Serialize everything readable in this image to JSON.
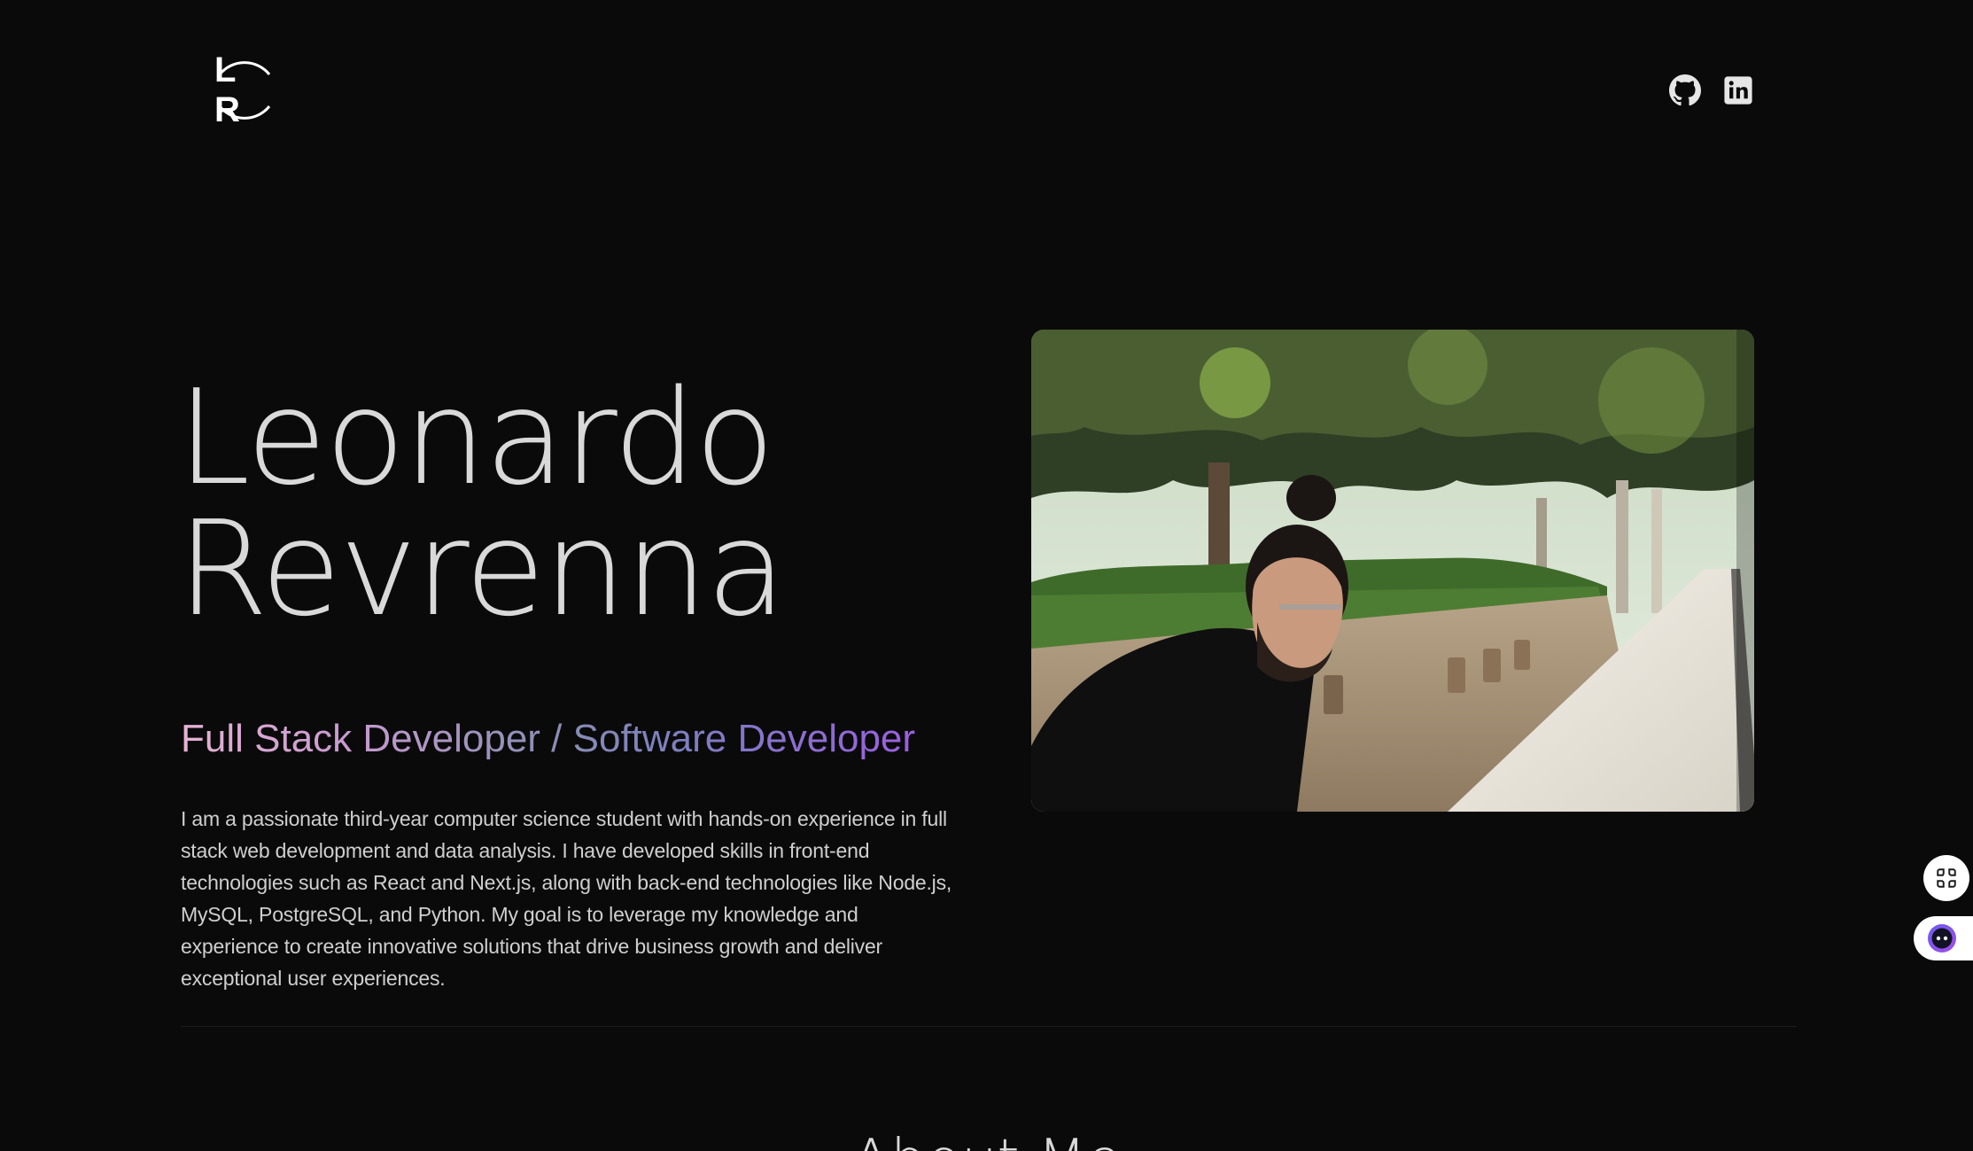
{
  "header": {
    "logo_text": "L R",
    "logo_icon": "lr-monogram-logo",
    "social": [
      {
        "name": "github",
        "icon": "github-icon"
      },
      {
        "name": "linkedin",
        "icon": "linkedin-icon"
      }
    ]
  },
  "hero": {
    "name_line1": "Leonardo",
    "name_line2": "Revrenna",
    "role": "Full Stack Developer / Software Developer",
    "description": "I am a passionate third-year computer science student with hands-on experience in full stack web development and data analysis. I have developed skills in front-end technologies such as React and Next.js, along with back-end technologies like Node.js, MySQL, PostgreSQL, and Python. My goal is to leverage my knowledge and experience to create innovative solutions that drive business growth and deliver exceptional user experiences.",
    "photo_icon": "profile-photo"
  },
  "about": {
    "heading": "About Me"
  },
  "widgets": {
    "apps_icon": "apps-grid-icon",
    "assistant_icon": "assistant-bot-icon"
  },
  "colors": {
    "background": "#0a0a0b",
    "text": "#d9d9d9",
    "gradient_start": "#e6b3d3",
    "gradient_mid": "#8a8fb3",
    "gradient_end": "#9b5fe0"
  }
}
